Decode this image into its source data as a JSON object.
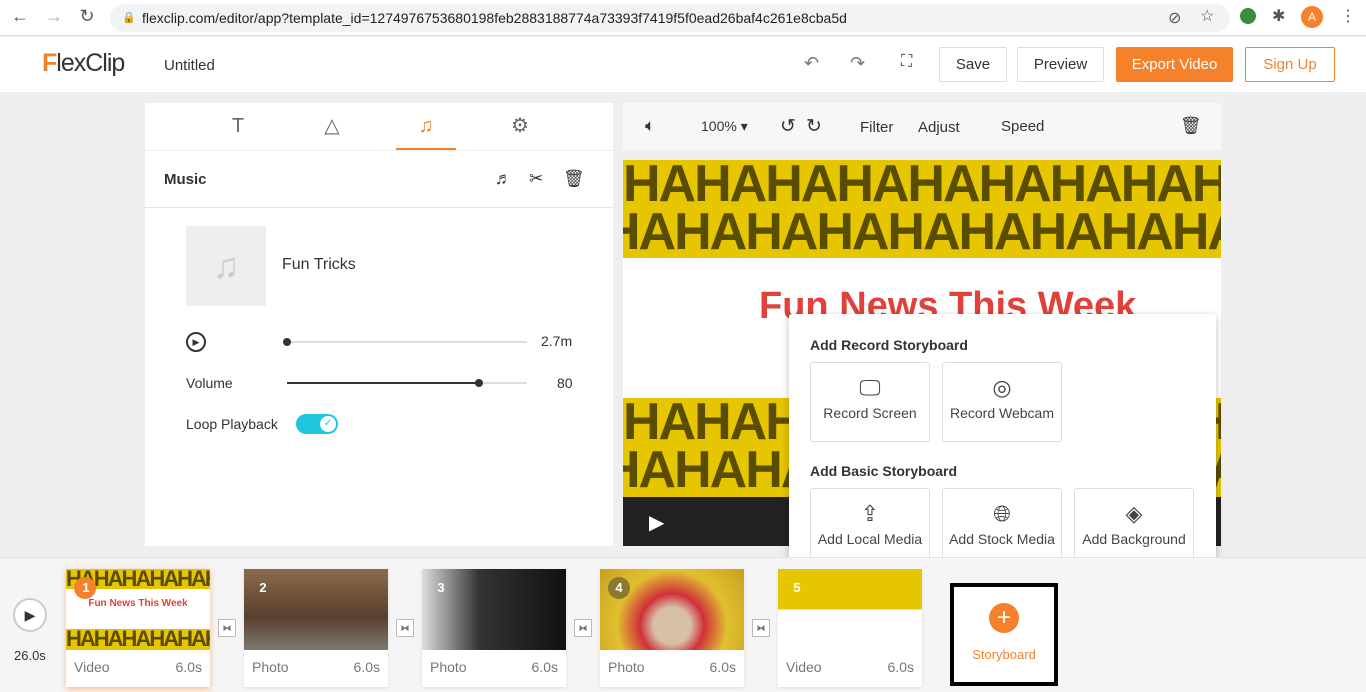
{
  "browser": {
    "url": "flexclip.com/editor/app?template_id=1274976753680198feb2883188774a73393f7419f5f0ead26baf4c261e8cba5d",
    "avatar": "A"
  },
  "header": {
    "logo": "FlexClip",
    "title": "Untitled",
    "save": "Save",
    "preview": "Preview",
    "export": "Export Video",
    "signup": "Sign Up"
  },
  "colors": {
    "accent": "#f6812b",
    "toggle": "#1fc6e0",
    "yellow": "#e6c600",
    "title_red": "#e0413a"
  },
  "left_panel": {
    "tabs": [
      "text-icon",
      "elements-icon",
      "music-icon",
      "settings-icon"
    ],
    "active_tab": 2,
    "section": "Music",
    "track": "Fun Tricks",
    "duration": "2.7m",
    "volume_label": "Volume",
    "volume": "80",
    "volume_fraction": 0.8,
    "progress_fraction": 0,
    "loop_label": "Loop Playback",
    "loop_on": true
  },
  "preview": {
    "zoom": "100%",
    "filter": "Filter",
    "adjust": "Adjust",
    "speed": "Speed",
    "haha": "HAHAHAHAHAHAHAHAHA",
    "video_title": "Fun News This Week"
  },
  "popup": {
    "record_title": "Add Record Storyboard",
    "record": [
      {
        "label": "Record Screen",
        "icon": "monitor-icon"
      },
      {
        "label": "Record Webcam",
        "icon": "webcam-icon"
      }
    ],
    "basic_title": "Add Basic Storyboard",
    "basic": [
      {
        "label": "Add Local Media",
        "icon": "upload-icon"
      },
      {
        "label": "Add Stock Media",
        "icon": "globe-icon"
      },
      {
        "label": "Add Background",
        "icon": "paint-bucket-icon"
      }
    ]
  },
  "timeline": {
    "total": "26.0s",
    "clips": [
      {
        "n": "1",
        "type": "Video",
        "dur": "6.0s"
      },
      {
        "n": "2",
        "type": "Photo",
        "dur": "6.0s"
      },
      {
        "n": "3",
        "type": "Photo",
        "dur": "6.0s"
      },
      {
        "n": "4",
        "type": "Photo",
        "dur": "6.0s"
      },
      {
        "n": "5",
        "type": "Video",
        "dur": "6.0s"
      }
    ],
    "add": "Storyboard"
  }
}
